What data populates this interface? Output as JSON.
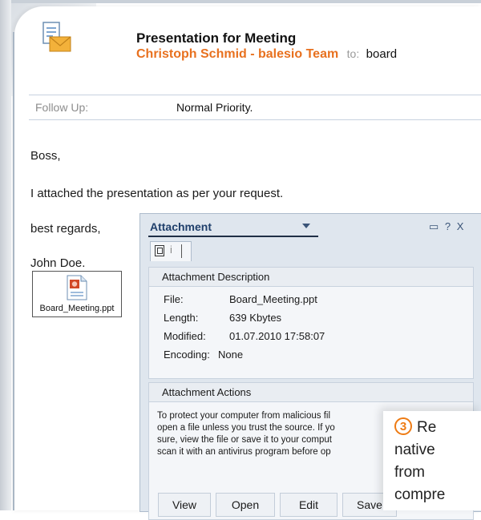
{
  "email": {
    "subject": "Presentation for Meeting",
    "from": "Christoph Schmid - balesio Team",
    "to_label": "to:",
    "to": "board",
    "follow_up_label": "Follow Up:",
    "priority": "Normal Priority."
  },
  "body": {
    "greeting": "Boss,",
    "line1": "I attached the presentation as per your request.",
    "closing": "best regards,",
    "signature": "John Doe."
  },
  "attachment_icon": {
    "filename": "Board_Meeting.ppt"
  },
  "panel": {
    "title": "Attachment",
    "controls": "▭ ? X",
    "tab_info": "i",
    "description_header": "Attachment Description",
    "details": [
      {
        "label": "File:",
        "value": "Board_Meeting.ppt"
      },
      {
        "label": "Length:",
        "value": "639 Kbytes"
      },
      {
        "label": "Modified:",
        "value": "01.07.2010 17:58:07"
      },
      {
        "label": "Encoding:",
        "value": "None"
      }
    ],
    "actions_header": "Attachment Actions",
    "actions_text": [
      "To protect your computer from malicious fil",
      "open a file unless you trust the source. If yo",
      "sure, view the file or save it to your comput",
      "scan it with an antivirus program before op"
    ],
    "buttons": [
      "View",
      "Open",
      "Edit",
      "Save"
    ]
  },
  "callout": {
    "number": "3",
    "lines": [
      "Re",
      "native",
      "from",
      "compre"
    ]
  }
}
